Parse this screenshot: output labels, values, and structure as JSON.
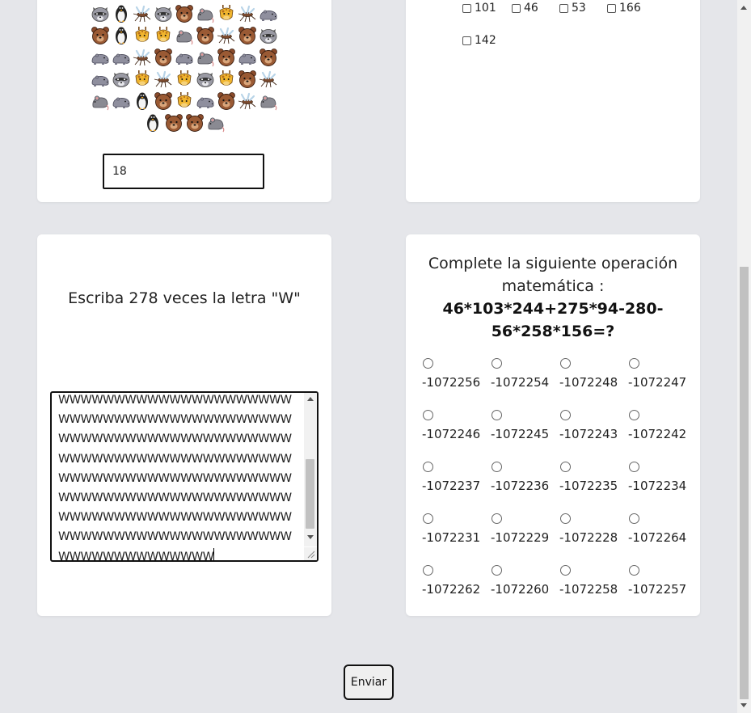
{
  "emoji_question": {
    "rows": [
      [
        "raccoon-icon",
        "penguin-icon",
        "mosquito-icon",
        "raccoon-icon",
        "bear-icon",
        "rat-icon",
        "giraffe-icon",
        "mosquito-icon",
        "hippo-icon"
      ],
      [
        "bear-icon",
        "penguin-icon",
        "giraffe-icon",
        "giraffe-icon",
        "rat-icon",
        "bear-icon",
        "mosquito-icon",
        "bear-icon",
        "raccoon-icon"
      ],
      [
        "hippo-icon",
        "hippo-icon",
        "mosquito-icon",
        "bear-icon",
        "hippo-icon",
        "rat-icon",
        "bear-icon",
        "hippo-icon",
        "bear-icon"
      ],
      [
        "hippo-icon",
        "raccoon-icon",
        "giraffe-icon",
        "mosquito-icon",
        "giraffe-icon",
        "raccoon-icon",
        "giraffe-icon",
        "bear-icon",
        "mosquito-icon"
      ],
      [
        "rat-icon",
        "hippo-icon",
        "penguin-icon",
        "bear-icon",
        "giraffe-icon",
        "hippo-icon",
        "bear-icon",
        "mosquito-icon",
        "rat-icon"
      ],
      [
        "penguin-icon",
        "bear-icon",
        "bear-icon",
        "rat-icon"
      ]
    ],
    "answer_value": "18"
  },
  "checkbox_question": {
    "options": [
      "101",
      "46",
      "53",
      "166",
      "142"
    ]
  },
  "text_question": {
    "prompt": "Escriba 278 veces la letra \"W\"",
    "lines": [
      "WWWWWWWWWWWWWWWWWWWWW",
      "WWWWWWWWWWWWWWWWWWWWW",
      "WWWWWWWWWWWWWWWWWWWWW",
      "WWWWWWWWWWWWWWWWWWWWW",
      "WWWWWWWWWWWWWWWWWWWWW",
      "WWWWWWWWWWWWWWWWWWWWW",
      "WWWWWWWWWWWWWWWWWWWWW",
      "WWWWWWWWWWWWWWWWWWWWW",
      "WWWWWWWWWWWWWW"
    ]
  },
  "math_question": {
    "title": "Complete la siguiente operación matemática :",
    "expression": "46*103*244+275*94-280-56*258*156=?",
    "options": [
      "-1072256",
      "-1072254",
      "-1072248",
      "-1072247",
      "-1072246",
      "-1072245",
      "-1072243",
      "-1072242",
      "-1072237",
      "-1072236",
      "-1072235",
      "-1072234",
      "-1072231",
      "-1072229",
      "-1072228",
      "-1072264",
      "-1072262",
      "-1072260",
      "-1072258",
      "-1072257"
    ]
  },
  "submit": {
    "label": "Enviar"
  },
  "colors": {
    "page_bg": "#e5e6ea",
    "card_bg": "#ffffff",
    "border": "#111111"
  }
}
